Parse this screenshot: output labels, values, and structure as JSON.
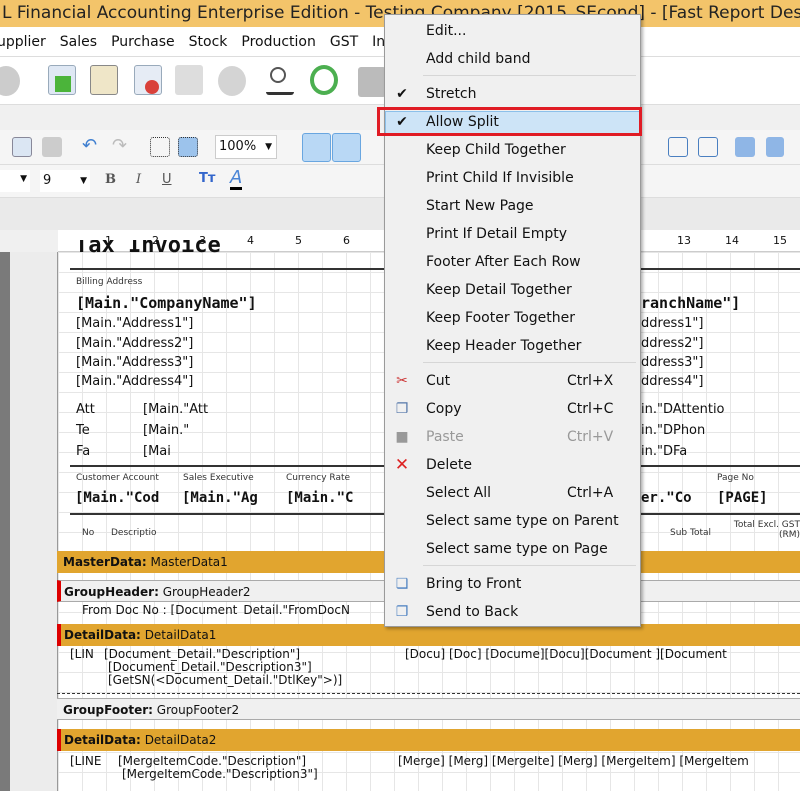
{
  "window": {
    "title": "L Financial Accounting Enterprise Edition - Testing Company [2015_SEcond] - [Fast Report Designer]"
  },
  "menu": [
    "upplier",
    "Sales",
    "Purchase",
    "Stock",
    "Production",
    "GST",
    "In"
  ],
  "toolbar": {
    "zoom": "100%",
    "font_size": "9",
    "bold": "B",
    "italic": "I",
    "underline": "U"
  },
  "ruler": [
    "1",
    "2",
    "3",
    "4",
    "5",
    "6",
    "13",
    "14",
    "15"
  ],
  "report": {
    "title": "Tax Invoice",
    "billing_label": "Billing Address",
    "company": "[Main.\"CompanyName\"]",
    "addr": [
      "[Main.\"Address1\"]",
      "[Main.\"Address2\"]",
      "[Main.\"Address3\"]",
      "[Main.\"Address4\"]"
    ],
    "branch": "ranchName\"]",
    "addr_r": [
      "ddress1\"]",
      "ddress2\"]",
      "ddress3\"]",
      "ddress4\"]"
    ],
    "att": [
      "Att",
      "Te",
      "Fa"
    ],
    "att_val": [
      "[Main.\"Att",
      "[Main.\"",
      "[Mai"
    ],
    "att_r": [
      "in.\"DAttentio",
      "in.\"DPhon",
      "in.\"DFa"
    ],
    "hdr_labels": [
      "Customer Account",
      "Sales Executive",
      "Currency Rate",
      "Page No"
    ],
    "hdr_vals": [
      "[Main.\"Cod",
      "[Main.\"Ag",
      "[Main.\"C",
      "er.\"Co",
      "[PAGE]"
    ],
    "cols": [
      "No",
      "Descriptio",
      "Sub Total",
      "Total Excl. GST (RM)"
    ],
    "bands": [
      {
        "type": "MasterData:",
        "name": "MasterData1"
      },
      {
        "type": "GroupHeader:",
        "name": "GroupHeader2"
      },
      {
        "type": "DetailData:",
        "name": "DetailData1"
      },
      {
        "type": "GroupFooter:",
        "name": "GroupFooter2"
      },
      {
        "type": "DetailData:",
        "name": "DetailData2"
      }
    ],
    "group_text": "From Doc No : [Document_Detail.\"FromDocN",
    "detail1": [
      "[LIN",
      "[Document_Detail.\"Description\"]",
      "[Document_Detail.\"Description3\"]",
      "[GetSN(<Document_Detail.\"DtlKey\">)]",
      "[Docu] [Doc] [Docume][Docu][Document  ][Document"
    ],
    "detail2": [
      "[LINE",
      "[MergeItemCode.\"Description\"]",
      "[MergeItemCode.\"Description3\"]",
      "[Merge] [Merg] [MergeIte] [Merg] [MergeItem] [MergeItem"
    ]
  },
  "context_menu": {
    "items": [
      {
        "label": "Edit..."
      },
      {
        "label": "Add child band"
      },
      {
        "label": "Stretch",
        "checked": true
      },
      {
        "label": "Allow Split",
        "checked": true,
        "highlighted": true
      },
      {
        "label": "Keep Child Together"
      },
      {
        "label": "Print Child If Invisible"
      },
      {
        "label": "Start New Page"
      },
      {
        "label": "Print If Detail Empty"
      },
      {
        "label": "Footer After Each Row"
      },
      {
        "label": "Keep Detail Together"
      },
      {
        "label": "Keep Footer Together"
      },
      {
        "label": "Keep Header Together"
      },
      {
        "label": "Cut",
        "shortcut": "Ctrl+X",
        "icon": "scissors-icon"
      },
      {
        "label": "Copy",
        "shortcut": "Ctrl+C",
        "icon": "copy-icon"
      },
      {
        "label": "Paste",
        "shortcut": "Ctrl+V",
        "disabled": true,
        "icon": "paste-icon"
      },
      {
        "label": "Delete",
        "icon": "delete-icon"
      },
      {
        "label": "Select All",
        "shortcut": "Ctrl+A"
      },
      {
        "label": "Select same type on Parent"
      },
      {
        "label": "Select same type on Page"
      },
      {
        "label": "Bring to Front",
        "icon": "bring-front-icon"
      },
      {
        "label": "Send to Back",
        "icon": "send-back-icon"
      }
    ],
    "check_glyph": "✔",
    "highlight_color": "#cde4f7",
    "callout_color": "#e01b24"
  }
}
